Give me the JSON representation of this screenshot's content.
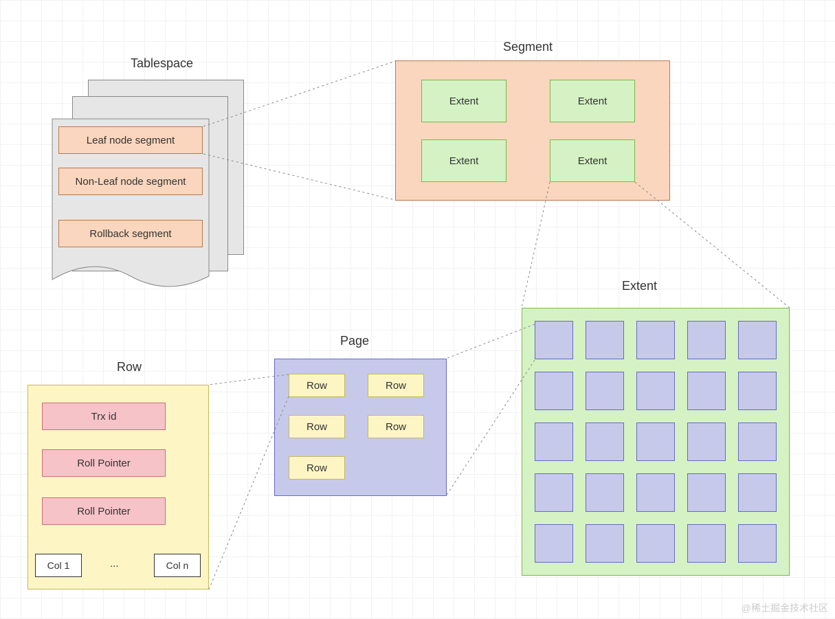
{
  "tablespace": {
    "title": "Tablespace",
    "segments": [
      "Leaf node segment",
      "Non-Leaf node segment",
      "Rollback  segment"
    ]
  },
  "segment": {
    "title": "Segment",
    "extents": [
      "Extent",
      "Extent",
      "Extent",
      "Extent"
    ]
  },
  "extent": {
    "title": "Extent",
    "page_count": 25
  },
  "page": {
    "title": "Page",
    "rows": [
      "Row",
      "Row",
      "Row",
      "Row",
      "Row"
    ]
  },
  "row": {
    "title": "Row",
    "fields": [
      "Trx id",
      "Roll Pointer",
      "Roll Pointer"
    ],
    "col_first": "Col 1",
    "col_ellipsis": "...",
    "col_last": "Col n"
  },
  "watermark": "@稀土掘金技术社区"
}
